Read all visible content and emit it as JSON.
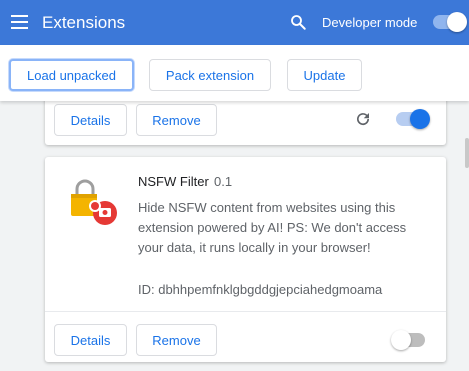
{
  "header": {
    "title": "Extensions",
    "developer_mode_label": "Developer mode",
    "developer_mode_on": true
  },
  "toolbar": {
    "load_unpacked": "Load unpacked",
    "pack_extension": "Pack extension",
    "update": "Update"
  },
  "previous_extension": {
    "details_label": "Details",
    "remove_label": "Remove",
    "enabled": true
  },
  "extension": {
    "name": "NSFW Filter",
    "version": "0.1",
    "description": "Hide NSFW content from websites using this extension powered by AI! PS: We don't access your data, it runs locally in your browser!",
    "id_text": "ID: dbhhpemfnklgbgddgjepciahedgmoama",
    "details_label": "Details",
    "remove_label": "Remove",
    "enabled": false,
    "icon": "lock-with-camera-icon"
  },
  "colors": {
    "header_bg": "#3c78d8",
    "accent": "#1a73e8"
  }
}
